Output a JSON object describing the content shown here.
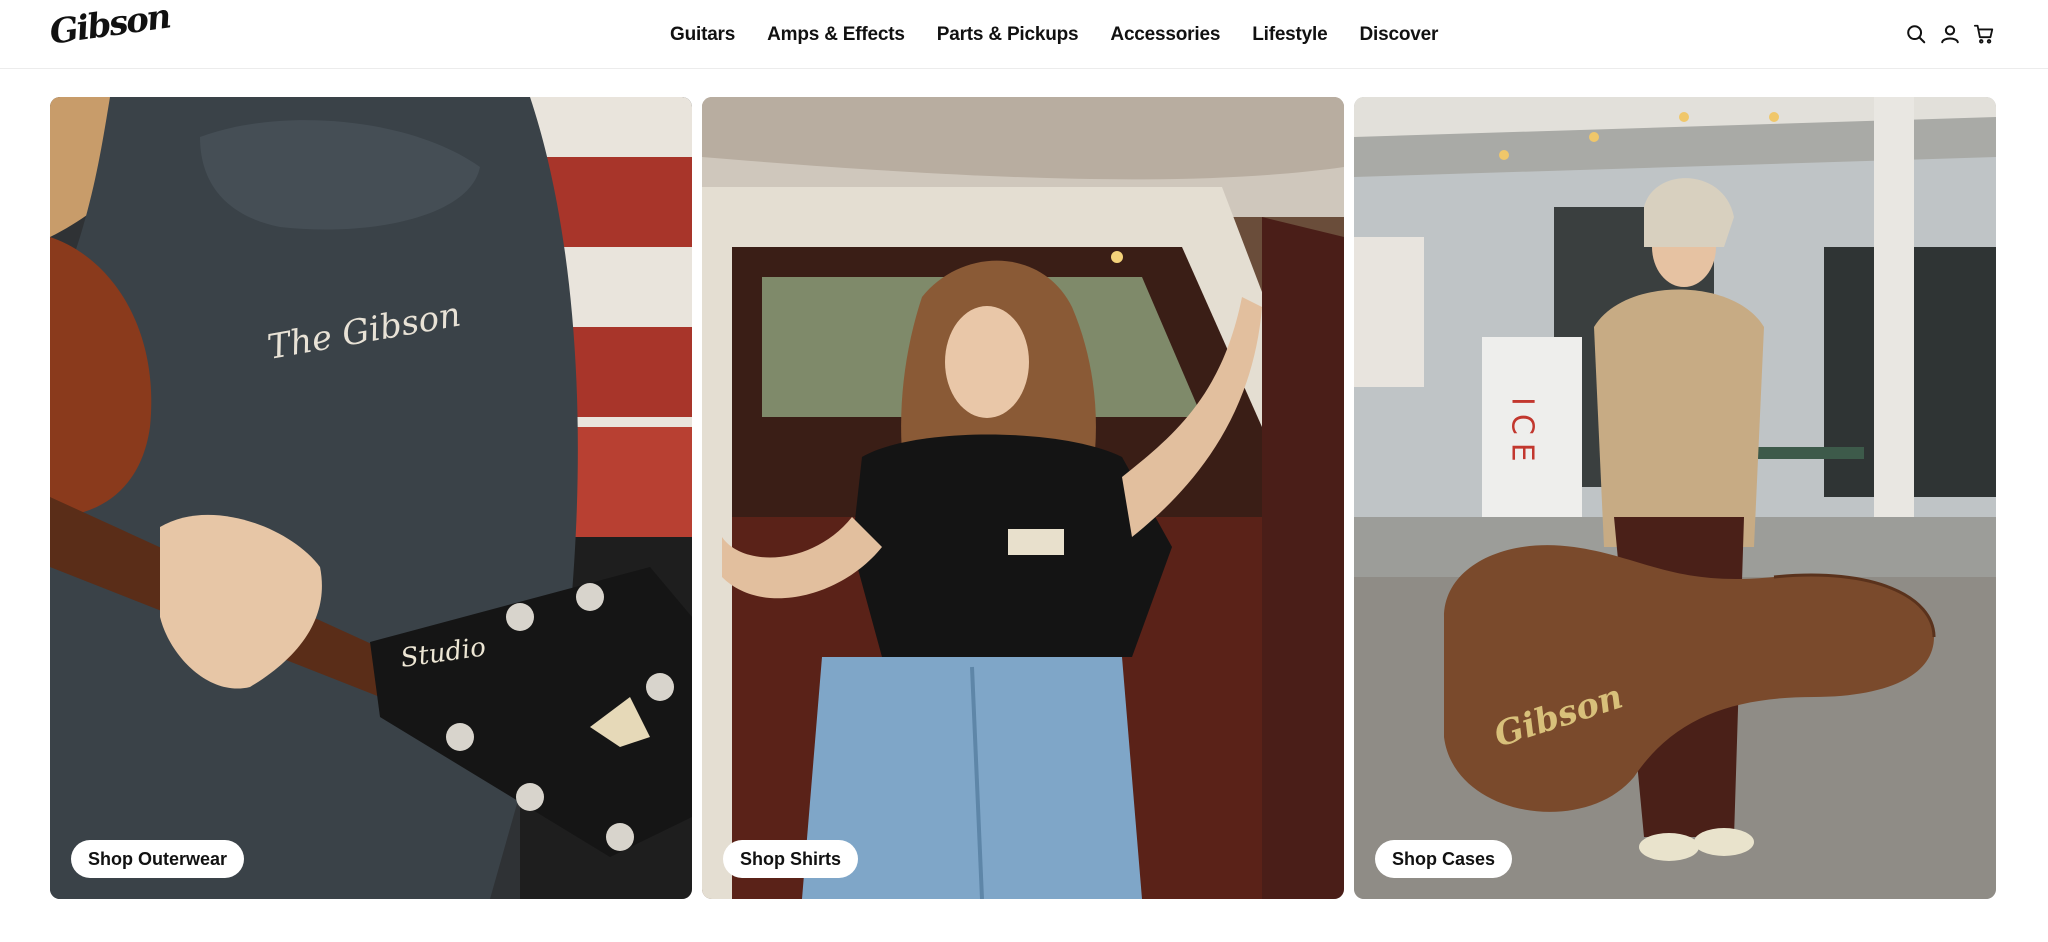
{
  "header": {
    "logo_text": "Gibson",
    "nav": [
      {
        "label": "Guitars"
      },
      {
        "label": "Amps & Effects"
      },
      {
        "label": "Parts & Pickups"
      },
      {
        "label": "Accessories"
      },
      {
        "label": "Lifestyle"
      },
      {
        "label": "Discover"
      }
    ],
    "icons": [
      "search-icon",
      "account-icon",
      "cart-icon"
    ]
  },
  "cards": [
    {
      "cta": "Shop Outerwear",
      "image": "person-playing-acoustic-guitar-in-hoodie",
      "print_text": "The Gibson",
      "headstock_text": "Studio"
    },
    {
      "cta": "Shop Shirts",
      "image": "woman-in-black-tshirt-sitting-in-truck"
    },
    {
      "cta": "Shop Cases",
      "image": "woman-holding-brown-guitar-case",
      "case_text": "Gibson",
      "sign_text": "ICE"
    }
  ],
  "colors": {
    "text": "#111111",
    "cta_bg": "#ffffff",
    "header_border": "#ececec"
  }
}
